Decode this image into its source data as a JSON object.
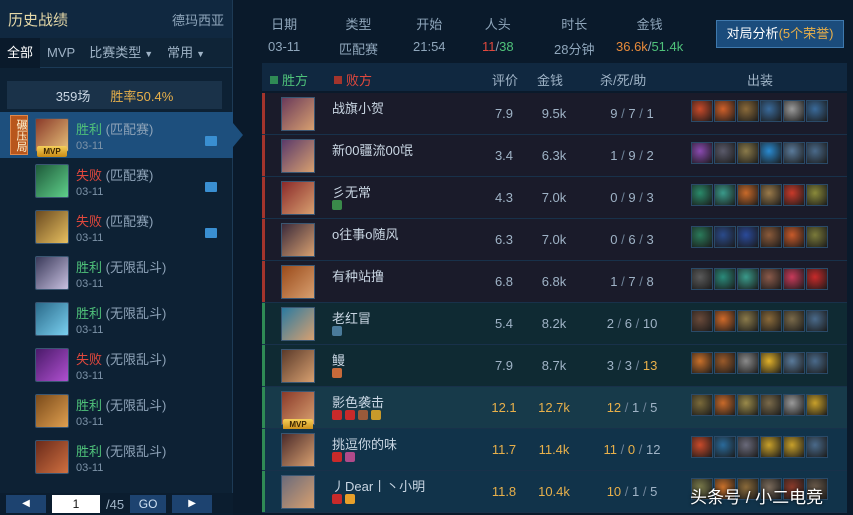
{
  "left": {
    "title": "历史战绩",
    "server": "德玛西亚",
    "filters": [
      "全部",
      "MVP",
      "比赛类型",
      "常用"
    ],
    "count": "359场",
    "winrate": "胜率50.4%",
    "matches": [
      {
        "result": "胜利",
        "mode": "(匹配赛)",
        "date": "03-11",
        "win": true,
        "tag": "碾压局",
        "mvp": "MVP",
        "replay": true,
        "colors": [
          "#8a3a2a",
          "#e8c27a"
        ]
      },
      {
        "result": "失败",
        "mode": "(匹配赛)",
        "date": "03-11",
        "win": false,
        "replay": true,
        "colors": [
          "#1e5a3a",
          "#5fd08a"
        ]
      },
      {
        "result": "失败",
        "mode": "(匹配赛)",
        "date": "03-11",
        "win": false,
        "replay": true,
        "colors": [
          "#6a4a20",
          "#e8c060"
        ]
      },
      {
        "result": "胜利",
        "mode": "(无限乱斗)",
        "date": "03-11",
        "win": true,
        "colors": [
          "#3a3a5a",
          "#c8c0e0"
        ]
      },
      {
        "result": "胜利",
        "mode": "(无限乱斗)",
        "date": "03-11",
        "win": true,
        "colors": [
          "#2a6a8a",
          "#7ad0f0"
        ]
      },
      {
        "result": "失败",
        "mode": "(无限乱斗)",
        "date": "03-11",
        "win": false,
        "colors": [
          "#4a1a6a",
          "#b050d0"
        ]
      },
      {
        "result": "胜利",
        "mode": "(无限乱斗)",
        "date": "03-11",
        "win": true,
        "colors": [
          "#7a4a1a",
          "#e0a050"
        ]
      },
      {
        "result": "胜利",
        "mode": "(无限乱斗)",
        "date": "03-11",
        "win": true,
        "colors": [
          "#6a2a1a",
          "#d07040"
        ]
      }
    ],
    "pager": {
      "page": "1",
      "total": "/45",
      "go": "GO"
    }
  },
  "summary": {
    "date_label": "日期",
    "date": "03-11",
    "type_label": "类型",
    "type": "匹配赛",
    "start_label": "开始",
    "start": "21:54",
    "kills_label": "人头",
    "kills_a": "11",
    "kills_sep": "/",
    "kills_b": "38",
    "dur_label": "时长",
    "dur": "28分钟",
    "gold_label": "金钱",
    "gold_a": "36.6k",
    "gold_sep": "/",
    "gold_b": "51.4k",
    "analysis": "对局分析",
    "analysis_extra": "(5个荣誉)"
  },
  "table": {
    "win_label": "胜方",
    "loss_label": "败方",
    "rating": "评价",
    "gold": "金钱",
    "kda": "杀/死/助",
    "items": "出装"
  },
  "players": [
    {
      "name": "战旗小贺",
      "rating": "7.9",
      "gold": "9.5k",
      "k": "9",
      "d": "7",
      "a": "1",
      "team": "loss",
      "icon": "#6a3a5a",
      "items": [
        "#c84a2a",
        "#d0602a",
        "#8a6a3a",
        "#3a6a9a",
        "#9a9a9a",
        "#3a6a9a"
      ]
    },
    {
      "name": "新00疆流00氓",
      "rating": "3.4",
      "gold": "6.3k",
      "k": "1",
      "d": "9",
      "a": "2",
      "team": "loss",
      "icon": "#5a3a6a",
      "items": [
        "#8a4ab0",
        "#5a5a6a",
        "#8a7a4a",
        "#2a8ad0",
        "#5a7a9a",
        "#4a6a8a"
      ]
    },
    {
      "name": "彡无常",
      "rating": "4.3",
      "gold": "7.0k",
      "k": "0",
      "d": "9",
      "a": "3",
      "team": "loss",
      "icon": "#8a2a2a",
      "items": [
        "#2a8a6a",
        "#3a9a8a",
        "#c86a2a",
        "#9a7a4a",
        "#c83a2a",
        "#8a8a3a"
      ],
      "badges": [
        "#3a8a4a"
      ]
    },
    {
      "name": "o往事o随风",
      "rating": "6.3",
      "gold": "7.0k",
      "k": "0",
      "d": "6",
      "a": "3",
      "team": "loss",
      "icon": "#3a2a3a",
      "items": [
        "#2a7a5a",
        "#2a4a8a",
        "#2a4a9a",
        "#8a5a3a",
        "#c85a2a",
        "#7a7a3a"
      ]
    },
    {
      "name": "有种站撸",
      "rating": "6.8",
      "gold": "6.8k",
      "k": "1",
      "d": "7",
      "a": "8",
      "team": "loss",
      "icon": "#9a4a1a",
      "items": [
        "#5a5a5a",
        "#2a8a7a",
        "#3a9a8a",
        "#8a5a4a",
        "#c83a5a",
        "#c82a2a"
      ]
    },
    {
      "name": "老红冒",
      "rating": "5.4",
      "gold": "8.2k",
      "k": "2",
      "d": "6",
      "a": "10",
      "team": "win",
      "icon": "#2a7aa0",
      "items": [
        "#6a4a3a",
        "#d06a2a",
        "#8a7a4a",
        "#8a6a3a",
        "#7a6a4a",
        "#4a6a8a"
      ],
      "badges": [
        "#4a7a9a"
      ]
    },
    {
      "name": "鳗",
      "rating": "7.9",
      "gold": "8.7k",
      "k": "3",
      "d": "3",
      "a": "13",
      "team": "win",
      "icon": "#5a3a2a",
      "items": [
        "#c8702a",
        "#9a5a2a",
        "#8a8a8a",
        "#e0b02a",
        "#5a7a9a",
        "#4a6a8a"
      ],
      "a_gold": true,
      "badges": [
        "#c86a3a"
      ]
    },
    {
      "name": "影色袭击",
      "rating": "12.1",
      "gold": "12.7k",
      "k": "12",
      "d": "1",
      "a": "5",
      "team": "win",
      "icon": "#8a3a2a",
      "items": [
        "#7a6a3a",
        "#c86a2a",
        "#9a8a4a",
        "#7a6a4a",
        "#9a9a9a",
        "#c8a02a"
      ],
      "mvp": "MVP",
      "gold_row": true,
      "highlight": true,
      "badges": [
        "#c82a2a",
        "#c82a2a",
        "#9a5a3a",
        "#c89a2a"
      ]
    },
    {
      "name": "挑逗你的味",
      "rating": "11.7",
      "gold": "11.4k",
      "k": "11",
      "d": "0",
      "a": "12",
      "team": "win",
      "icon": "#4a2a2a",
      "items": [
        "#c84a2a",
        "#2a6a9a",
        "#6a6a7a",
        "#c8a02a",
        "#c8a02a",
        "#4a6a8a"
      ],
      "gold_row": true,
      "d_gold": true,
      "badges": [
        "#c82a2a",
        "#b04a8a"
      ]
    },
    {
      "name": "丿Dear丨丶小明",
      "rating": "11.8",
      "gold": "10.4k",
      "k": "10",
      "d": "1",
      "a": "5",
      "team": "win",
      "icon": "#6a6a7a",
      "items": [
        "#7a7a4a",
        "#c8702a",
        "#8a6a3a",
        "#7a6a5a",
        "#8a3a2a",
        "#6a5a4a"
      ],
      "gold_row": true,
      "badges": [
        "#c82a2a",
        "#e8a02a"
      ]
    }
  ],
  "watermark": "头条号 / 小二电竞",
  "colors": {
    "win": "#4fc27a",
    "loss": "#e0483d",
    "accent": "#e8b04a",
    "bg": "#0a1a2b"
  }
}
